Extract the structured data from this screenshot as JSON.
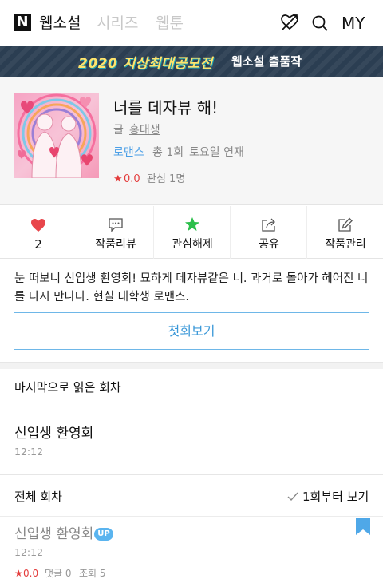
{
  "header": {
    "logo": "N",
    "nav": [
      "웹소설",
      "시리즈",
      "웹툰"
    ],
    "my_label": "MY",
    "icons": [
      "cupid-heart-icon",
      "search-icon"
    ]
  },
  "banner": {
    "main": "2020 지상최대공모전",
    "sub": "웹소설 출품작"
  },
  "work": {
    "title": "너를 데자뷰 해!",
    "author_prefix": "글",
    "author": "홍대생",
    "genre": "로맨스",
    "episodes": "총 1회",
    "schedule": "토요일 연재",
    "rating_star": "★",
    "rating": "0.0",
    "interest": "관심 1명"
  },
  "actions": [
    {
      "label": "2",
      "icon": "heart-icon",
      "color": "#e8464b"
    },
    {
      "label": "작품리뷰",
      "icon": "comment-icon"
    },
    {
      "label": "관심해제",
      "icon": "star-icon",
      "color": "#2cbf4b"
    },
    {
      "label": "공유",
      "icon": "share-icon"
    },
    {
      "label": "작품관리",
      "icon": "edit-icon"
    }
  ],
  "synopsis": "눈 떠보니 신입생 환영회! 묘하게 데자뷰같은 너. 과거로 돌아가 헤어진 너를 다시 만나다. 현실 대학생 로맨스.",
  "first_button": "첫회보기",
  "last_read": {
    "heading": "마지막으로 읽은 회차",
    "title": "신입생 환영회",
    "date": "12:12"
  },
  "all_episodes": {
    "heading": "전체 회차",
    "from_first": "1회부터 보기",
    "items": [
      {
        "title": "신입생 환영회",
        "badge": "UP",
        "date": "12:12",
        "star": "★",
        "rating": "0.0",
        "comments": "댓글 0",
        "views": "조회 5"
      }
    ]
  },
  "colors": {
    "accent_blue": "#3b98d8",
    "genre_blue": "#4b9fe6",
    "rating_red": "#e43d3d",
    "heart_red": "#e8464b",
    "star_green": "#2cbf4b",
    "banner_bg": "#2b3e52",
    "banner_text": "#ffe36b"
  }
}
